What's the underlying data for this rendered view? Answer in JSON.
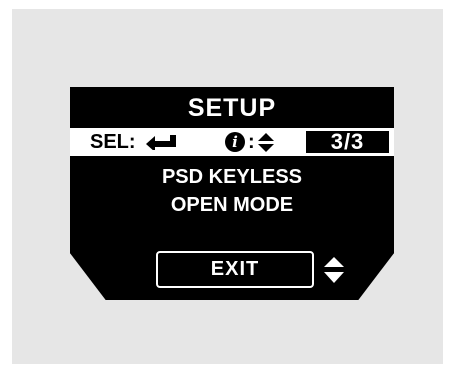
{
  "screen": {
    "title": "SETUP",
    "select_label": "SEL:",
    "select_icon": "enter-arrow-icon",
    "info_icon_glyph": "i",
    "info_colon": ":",
    "info_scroll_icon": "up-down-arrows-icon",
    "page_indicator": "3/3",
    "message_lines": [
      "PSD KEYLESS",
      "OPEN MODE"
    ],
    "exit_label": "EXIT",
    "exit_scroll_icon": "up-down-arrows-icon"
  },
  "colors": {
    "background": "#e6e6e6",
    "display": "#000000",
    "text": "#ffffff"
  }
}
